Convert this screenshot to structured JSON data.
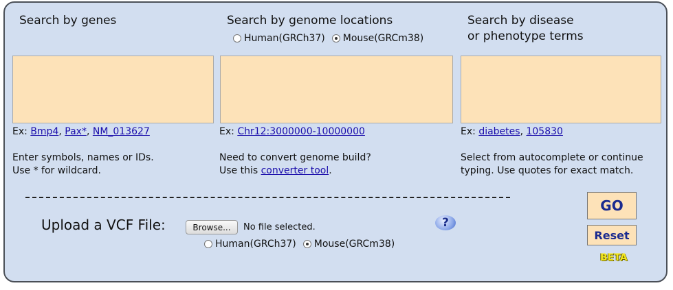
{
  "genes": {
    "title": "Search by genes",
    "example_prefix": "Ex: ",
    "examples": [
      "Bmp4",
      "Pax*",
      "NM_013627"
    ],
    "help_line1": "Enter symbols, names or IDs.",
    "help_line2": "Use * for wildcard."
  },
  "locations": {
    "title": "Search by genome locations",
    "radio_human": "Human(GRCh37)",
    "radio_mouse": "Mouse(GRCm38)",
    "selected": "mouse",
    "example_prefix": "Ex: ",
    "example": "Chr12:3000000-10000000",
    "help_line1": "Need to convert genome build?",
    "help_line2_prefix": "Use this ",
    "help_link": "converter tool",
    "help_line2_suffix": "."
  },
  "disease": {
    "title_line1": "Search by disease",
    "title_line2": "or phenotype terms",
    "example_prefix": "Ex: ",
    "examples": [
      "diabetes",
      "105830"
    ],
    "help_line1": "Select from autocomplete or continue",
    "help_line2": "typing. Use quotes for exact match."
  },
  "vcf": {
    "label": "Upload a VCF File:",
    "browse_label": "Browse...",
    "no_file_text": "No file selected.",
    "radio_human": "Human(GRCh37)",
    "radio_mouse": "Mouse(GRCm38)",
    "selected": "mouse",
    "help_icon": "?"
  },
  "actions": {
    "go_label": "GO",
    "reset_label": "Reset",
    "beta_label": "BETA"
  }
}
